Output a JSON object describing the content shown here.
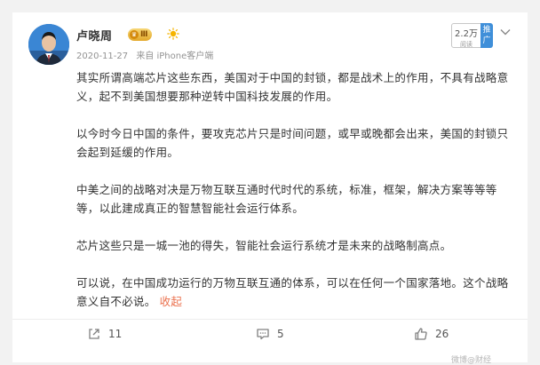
{
  "post": {
    "author": {
      "name": "卢晓周",
      "vip_level": "Ⅲ"
    },
    "meta": {
      "date": "2020-11-27",
      "source": "来自 iPhone客户端"
    },
    "read": {
      "count": "2.2万",
      "label": "阅读"
    },
    "promote_label": "推广",
    "paragraphs": [
      "其实所谓高端芯片这些东西，美国对于中国的封锁，都是战术上的作用，不具有战略意义，起不到美国想要那种逆转中国科技发展的作用。",
      "以今时今日中国的条件，要攻克芯片只是时间问题，或早或晚都会出来，美国的封锁只会起到延缓的作用。",
      "中美之间的战略对决是万物互联互通时代时代的系统，标准，框架，解决方案等等等等，以此建成真正的智慧智能社会运行体系。",
      "芯片这些只是一城一池的得失，智能社会运行系统才是未来的战略制高点。",
      "可以说，在中国成功运行的万物互联互通的体系，可以在任何一个国家落地。这个战略意义自不必说。"
    ],
    "collapse_label": "收起",
    "actions": {
      "repost_count": "11",
      "comment_count": "5",
      "like_count": "26"
    }
  },
  "watermark": "微博@财经"
}
